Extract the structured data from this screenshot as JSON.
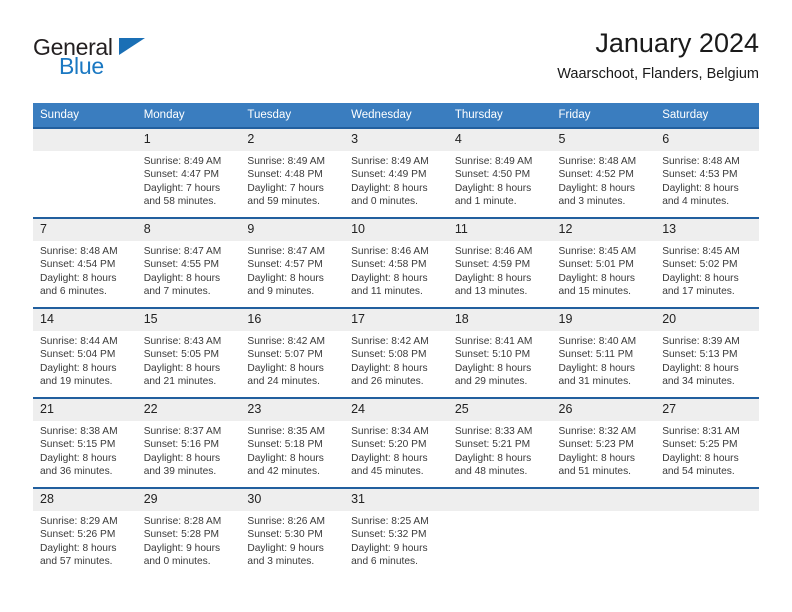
{
  "brand": {
    "name_top": "General",
    "name_bottom": "Blue",
    "triangle_icon": "triangle-icon",
    "color_dark": "#231f20",
    "color_blue": "#1a78c2"
  },
  "header": {
    "title": "January 2024",
    "subtitle": "Waarschoot, Flanders, Belgium"
  },
  "theme": {
    "header_row_bg": "#3a7dbf",
    "cell_top_border": "#225f9e",
    "daynum_bg": "#eeeeee"
  },
  "weekday_headers": [
    "Sunday",
    "Monday",
    "Tuesday",
    "Wednesday",
    "Thursday",
    "Friday",
    "Saturday"
  ],
  "weeks": [
    [
      {
        "day": "",
        "sunrise": "",
        "sunset": "",
        "daylight_line1": "",
        "daylight_line2": ""
      },
      {
        "day": "1",
        "sunrise": "Sunrise: 8:49 AM",
        "sunset": "Sunset: 4:47 PM",
        "daylight_line1": "Daylight: 7 hours",
        "daylight_line2": "and 58 minutes."
      },
      {
        "day": "2",
        "sunrise": "Sunrise: 8:49 AM",
        "sunset": "Sunset: 4:48 PM",
        "daylight_line1": "Daylight: 7 hours",
        "daylight_line2": "and 59 minutes."
      },
      {
        "day": "3",
        "sunrise": "Sunrise: 8:49 AM",
        "sunset": "Sunset: 4:49 PM",
        "daylight_line1": "Daylight: 8 hours",
        "daylight_line2": "and 0 minutes."
      },
      {
        "day": "4",
        "sunrise": "Sunrise: 8:49 AM",
        "sunset": "Sunset: 4:50 PM",
        "daylight_line1": "Daylight: 8 hours",
        "daylight_line2": "and 1 minute."
      },
      {
        "day": "5",
        "sunrise": "Sunrise: 8:48 AM",
        "sunset": "Sunset: 4:52 PM",
        "daylight_line1": "Daylight: 8 hours",
        "daylight_line2": "and 3 minutes."
      },
      {
        "day": "6",
        "sunrise": "Sunrise: 8:48 AM",
        "sunset": "Sunset: 4:53 PM",
        "daylight_line1": "Daylight: 8 hours",
        "daylight_line2": "and 4 minutes."
      }
    ],
    [
      {
        "day": "7",
        "sunrise": "Sunrise: 8:48 AM",
        "sunset": "Sunset: 4:54 PM",
        "daylight_line1": "Daylight: 8 hours",
        "daylight_line2": "and 6 minutes."
      },
      {
        "day": "8",
        "sunrise": "Sunrise: 8:47 AM",
        "sunset": "Sunset: 4:55 PM",
        "daylight_line1": "Daylight: 8 hours",
        "daylight_line2": "and 7 minutes."
      },
      {
        "day": "9",
        "sunrise": "Sunrise: 8:47 AM",
        "sunset": "Sunset: 4:57 PM",
        "daylight_line1": "Daylight: 8 hours",
        "daylight_line2": "and 9 minutes."
      },
      {
        "day": "10",
        "sunrise": "Sunrise: 8:46 AM",
        "sunset": "Sunset: 4:58 PM",
        "daylight_line1": "Daylight: 8 hours",
        "daylight_line2": "and 11 minutes."
      },
      {
        "day": "11",
        "sunrise": "Sunrise: 8:46 AM",
        "sunset": "Sunset: 4:59 PM",
        "daylight_line1": "Daylight: 8 hours",
        "daylight_line2": "and 13 minutes."
      },
      {
        "day": "12",
        "sunrise": "Sunrise: 8:45 AM",
        "sunset": "Sunset: 5:01 PM",
        "daylight_line1": "Daylight: 8 hours",
        "daylight_line2": "and 15 minutes."
      },
      {
        "day": "13",
        "sunrise": "Sunrise: 8:45 AM",
        "sunset": "Sunset: 5:02 PM",
        "daylight_line1": "Daylight: 8 hours",
        "daylight_line2": "and 17 minutes."
      }
    ],
    [
      {
        "day": "14",
        "sunrise": "Sunrise: 8:44 AM",
        "sunset": "Sunset: 5:04 PM",
        "daylight_line1": "Daylight: 8 hours",
        "daylight_line2": "and 19 minutes."
      },
      {
        "day": "15",
        "sunrise": "Sunrise: 8:43 AM",
        "sunset": "Sunset: 5:05 PM",
        "daylight_line1": "Daylight: 8 hours",
        "daylight_line2": "and 21 minutes."
      },
      {
        "day": "16",
        "sunrise": "Sunrise: 8:42 AM",
        "sunset": "Sunset: 5:07 PM",
        "daylight_line1": "Daylight: 8 hours",
        "daylight_line2": "and 24 minutes."
      },
      {
        "day": "17",
        "sunrise": "Sunrise: 8:42 AM",
        "sunset": "Sunset: 5:08 PM",
        "daylight_line1": "Daylight: 8 hours",
        "daylight_line2": "and 26 minutes."
      },
      {
        "day": "18",
        "sunrise": "Sunrise: 8:41 AM",
        "sunset": "Sunset: 5:10 PM",
        "daylight_line1": "Daylight: 8 hours",
        "daylight_line2": "and 29 minutes."
      },
      {
        "day": "19",
        "sunrise": "Sunrise: 8:40 AM",
        "sunset": "Sunset: 5:11 PM",
        "daylight_line1": "Daylight: 8 hours",
        "daylight_line2": "and 31 minutes."
      },
      {
        "day": "20",
        "sunrise": "Sunrise: 8:39 AM",
        "sunset": "Sunset: 5:13 PM",
        "daylight_line1": "Daylight: 8 hours",
        "daylight_line2": "and 34 minutes."
      }
    ],
    [
      {
        "day": "21",
        "sunrise": "Sunrise: 8:38 AM",
        "sunset": "Sunset: 5:15 PM",
        "daylight_line1": "Daylight: 8 hours",
        "daylight_line2": "and 36 minutes."
      },
      {
        "day": "22",
        "sunrise": "Sunrise: 8:37 AM",
        "sunset": "Sunset: 5:16 PM",
        "daylight_line1": "Daylight: 8 hours",
        "daylight_line2": "and 39 minutes."
      },
      {
        "day": "23",
        "sunrise": "Sunrise: 8:35 AM",
        "sunset": "Sunset: 5:18 PM",
        "daylight_line1": "Daylight: 8 hours",
        "daylight_line2": "and 42 minutes."
      },
      {
        "day": "24",
        "sunrise": "Sunrise: 8:34 AM",
        "sunset": "Sunset: 5:20 PM",
        "daylight_line1": "Daylight: 8 hours",
        "daylight_line2": "and 45 minutes."
      },
      {
        "day": "25",
        "sunrise": "Sunrise: 8:33 AM",
        "sunset": "Sunset: 5:21 PM",
        "daylight_line1": "Daylight: 8 hours",
        "daylight_line2": "and 48 minutes."
      },
      {
        "day": "26",
        "sunrise": "Sunrise: 8:32 AM",
        "sunset": "Sunset: 5:23 PM",
        "daylight_line1": "Daylight: 8 hours",
        "daylight_line2": "and 51 minutes."
      },
      {
        "day": "27",
        "sunrise": "Sunrise: 8:31 AM",
        "sunset": "Sunset: 5:25 PM",
        "daylight_line1": "Daylight: 8 hours",
        "daylight_line2": "and 54 minutes."
      }
    ],
    [
      {
        "day": "28",
        "sunrise": "Sunrise: 8:29 AM",
        "sunset": "Sunset: 5:26 PM",
        "daylight_line1": "Daylight: 8 hours",
        "daylight_line2": "and 57 minutes."
      },
      {
        "day": "29",
        "sunrise": "Sunrise: 8:28 AM",
        "sunset": "Sunset: 5:28 PM",
        "daylight_line1": "Daylight: 9 hours",
        "daylight_line2": "and 0 minutes."
      },
      {
        "day": "30",
        "sunrise": "Sunrise: 8:26 AM",
        "sunset": "Sunset: 5:30 PM",
        "daylight_line1": "Daylight: 9 hours",
        "daylight_line2": "and 3 minutes."
      },
      {
        "day": "31",
        "sunrise": "Sunrise: 8:25 AM",
        "sunset": "Sunset: 5:32 PM",
        "daylight_line1": "Daylight: 9 hours",
        "daylight_line2": "and 6 minutes."
      },
      {
        "day": "",
        "sunrise": "",
        "sunset": "",
        "daylight_line1": "",
        "daylight_line2": ""
      },
      {
        "day": "",
        "sunrise": "",
        "sunset": "",
        "daylight_line1": "",
        "daylight_line2": ""
      },
      {
        "day": "",
        "sunrise": "",
        "sunset": "",
        "daylight_line1": "",
        "daylight_line2": ""
      }
    ]
  ]
}
